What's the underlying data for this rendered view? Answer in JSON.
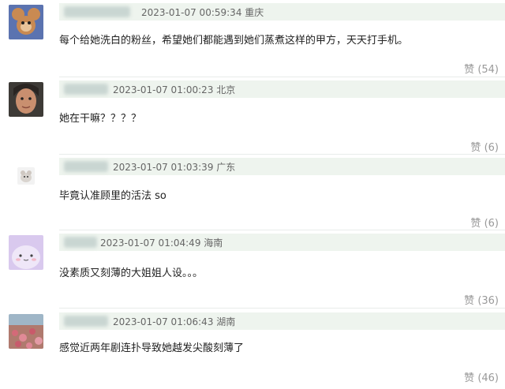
{
  "comments": [
    {
      "time": "2023-01-07 00:59:34",
      "location": "重庆",
      "text": "每个给她洗白的粉丝，希望她们都能遇到她们蒸煮这样的甲方，天天打手机。",
      "like_label": "赞",
      "like_count": "(54)",
      "avatar": "cartoon-mouse-avatar"
    },
    {
      "time": "2023-01-07 01:00:23",
      "location": "北京",
      "text": "她在干嘛？？？？",
      "like_label": "赞",
      "like_count": "(6)",
      "avatar": "woman-photo-avatar"
    },
    {
      "time": "2023-01-07 01:03:39",
      "location": "广东",
      "text": "毕竟认准顾里的活法 so",
      "like_label": "赞",
      "like_count": "(6)",
      "avatar": "small-pet-avatar"
    },
    {
      "time": "2023-01-07 01:04:49",
      "location": "海南",
      "text": "没素质又刻薄的大姐姐人设。。。",
      "like_label": "赞",
      "like_count": "(36)",
      "avatar": "purple-blob-avatar"
    },
    {
      "time": "2023-01-07 01:06:43",
      "location": "湖南",
      "text": "感觉近两年剧连扑导致她越发尖酸刻薄了",
      "like_label": "赞",
      "like_count": "(46)",
      "avatar": "flowers-photo-avatar"
    }
  ]
}
